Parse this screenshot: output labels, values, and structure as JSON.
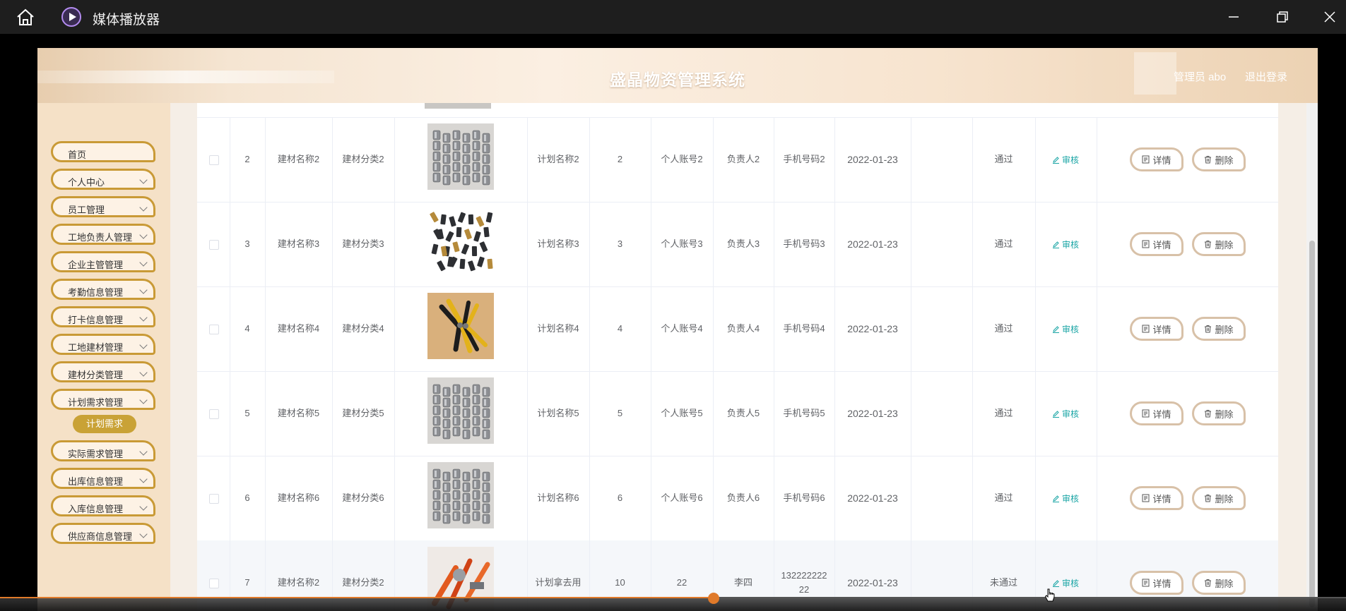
{
  "player": {
    "title": "媒体播放器",
    "accent": "#e07a2a",
    "progress_fraction": 0.53,
    "time_elapsed": "",
    "time_total": ""
  },
  "app": {
    "title": "盛晶物资管理系统",
    "user": "管理员 abo",
    "logout": "退出登录"
  },
  "sidebar": {
    "items": [
      {
        "label": "首页",
        "expandable": false
      },
      {
        "label": "个人中心",
        "expandable": true
      },
      {
        "label": "员工管理",
        "expandable": true
      },
      {
        "label": "工地负责人管理",
        "expandable": true
      },
      {
        "label": "企业主管管理",
        "expandable": true
      },
      {
        "label": "考勤信息管理",
        "expandable": true
      },
      {
        "label": "打卡信息管理",
        "expandable": true
      },
      {
        "label": "工地建材管理",
        "expandable": true
      },
      {
        "label": "建材分类管理",
        "expandable": true
      },
      {
        "label": "计划需求管理",
        "expandable": true
      },
      {
        "label": "实际需求管理",
        "expandable": true
      },
      {
        "label": "出库信息管理",
        "expandable": true
      },
      {
        "label": "入库信息管理",
        "expandable": true
      },
      {
        "label": "供应商信息管理",
        "expandable": true
      }
    ],
    "sub_item": "计划需求"
  },
  "table": {
    "actions": {
      "audit": "审核",
      "detail": "详情",
      "delete": "删除"
    },
    "rows": [
      {
        "index": "2",
        "name": "建材名称2",
        "category": "建材分类2",
        "image": "bolts",
        "plan": "计划名称2",
        "qty": "2",
        "account": "个人账号2",
        "manager": "负责人2",
        "phone": "手机号码2",
        "date": "2022-01-23",
        "status": "通过"
      },
      {
        "index": "3",
        "name": "建材名称3",
        "category": "建材分类3",
        "image": "clips",
        "plan": "计划名称3",
        "qty": "3",
        "account": "个人账号3",
        "manager": "负责人3",
        "phone": "手机号码3",
        "date": "2022-01-23",
        "status": "通过"
      },
      {
        "index": "4",
        "name": "建材名称4",
        "category": "建材分类4",
        "image": "pliers",
        "plan": "计划名称4",
        "qty": "4",
        "account": "个人账号4",
        "manager": "负责人4",
        "phone": "手机号码4",
        "date": "2022-01-23",
        "status": "通过"
      },
      {
        "index": "5",
        "name": "建材名称5",
        "category": "建材分类5",
        "image": "bolts",
        "plan": "计划名称5",
        "qty": "5",
        "account": "个人账号5",
        "manager": "负责人5",
        "phone": "手机号码5",
        "date": "2022-01-23",
        "status": "通过"
      },
      {
        "index": "6",
        "name": "建材名称6",
        "category": "建材分类6",
        "image": "bolts",
        "plan": "计划名称6",
        "qty": "6",
        "account": "个人账号6",
        "manager": "负责人6",
        "phone": "手机号码6",
        "date": "2022-01-23",
        "status": "通过"
      },
      {
        "index": "7",
        "name": "建材名称2",
        "category": "建材分类2",
        "image": "tools-red",
        "plan": "计划拿去用",
        "qty": "10",
        "account": "22",
        "manager": "李四",
        "phone": "13222222222",
        "date": "2022-01-23",
        "status": "未通过"
      }
    ]
  }
}
